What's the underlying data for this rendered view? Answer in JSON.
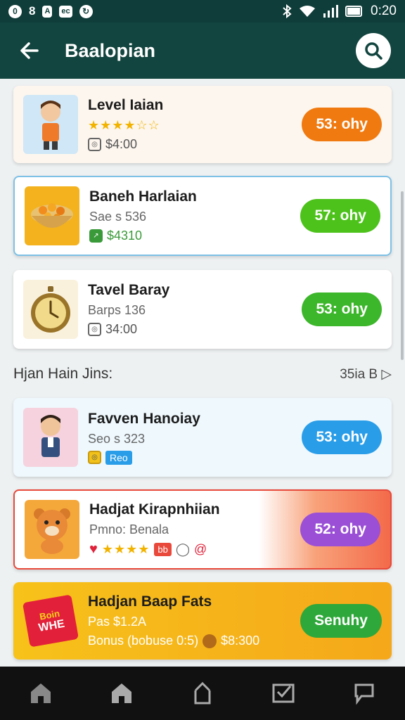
{
  "status_bar": {
    "left_text": "8",
    "left_box1": "A",
    "left_box2": "ec",
    "time": "0:20"
  },
  "app_bar": {
    "title": "Baalopian"
  },
  "cards": [
    {
      "title": "Level Iaian",
      "rating_stars": 6,
      "meta": "$4:00",
      "button": "53: ohy",
      "button_color": "#f07a10"
    },
    {
      "title": "Baneh Harlaian",
      "sub": "Sae s 536",
      "meta": "$4310",
      "button": "57: ohy",
      "button_color": "#4cc21a"
    },
    {
      "title": "Tavel Baray",
      "sub": "Barps 136",
      "meta": "34:00",
      "button": "53: ohy",
      "button_color": "#3cb62a"
    }
  ],
  "section": {
    "title": "Hjan Hain Jins:",
    "link": "35ia B"
  },
  "cards2": [
    {
      "title": "Favven Hanoiay",
      "sub": "Seo s 323",
      "badge": "Reo",
      "button": "53: ohy",
      "button_color": "#2a9de8"
    },
    {
      "title": "Hadjat Kirapnhiian",
      "sub": "Pmno: Benala",
      "rating_stars": 4,
      "tag": "bb",
      "button": "52: ohy",
      "button_color": "#9a4fd6"
    },
    {
      "title": "Hadjan Baap Fats",
      "sub": "Pas $1.2A",
      "bonus": "Bonus (bobuse 0:5)",
      "bonus_value": "$8:300",
      "button": "Senuhy",
      "button_color": "#2ea83a",
      "promo_line1": "Boin",
      "promo_line2": "WHE"
    }
  ],
  "colors": {
    "status_bg": "#0f3d3a",
    "appbar_bg": "#12453f",
    "promo_bg": "#f5b41a",
    "nav_bg": "#111111"
  },
  "icons": {
    "back": "arrow-left-icon",
    "search": "search-icon",
    "nav": [
      "home-icon",
      "home-filled-icon",
      "share-icon",
      "inbox-check-icon",
      "chat-icon"
    ]
  }
}
